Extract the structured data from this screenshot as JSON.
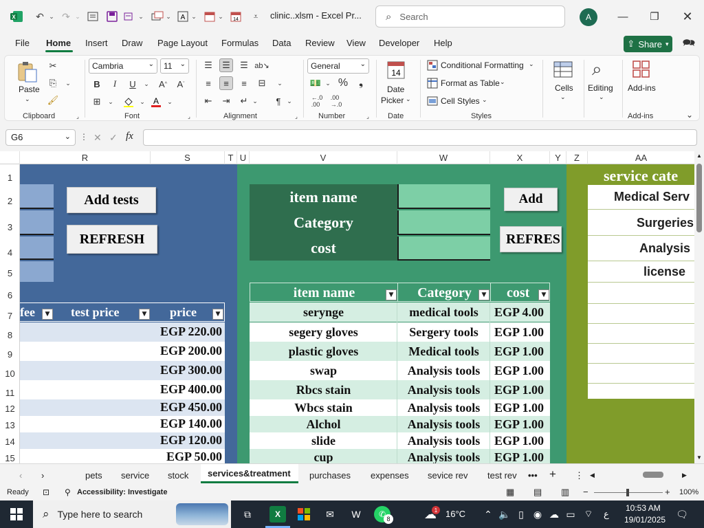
{
  "title_bar": {
    "doc_title": "clinic..xlsm - Excel Pr...",
    "search_placeholder": "Search",
    "avatar_initial": "A"
  },
  "menu": {
    "tabs": [
      "File",
      "Home",
      "Insert",
      "Draw",
      "Page Layout",
      "Formulas",
      "Data",
      "Review",
      "View",
      "Developer",
      "Help"
    ],
    "share_label": "Share"
  },
  "ribbon": {
    "clipboard": {
      "paste": "Paste",
      "label": "Clipboard"
    },
    "font": {
      "name": "Cambria",
      "size": "11",
      "label": "Font"
    },
    "alignment": {
      "label": "Alignment"
    },
    "number": {
      "format": "General",
      "label": "Number"
    },
    "date": {
      "line1": "Date",
      "line2": "Picker",
      "label": "Date",
      "icon_num": "14"
    },
    "styles": {
      "conditional": "Conditional Formatting",
      "format_table": "Format as Table",
      "cell_styles": "Cell Styles",
      "label": "Styles"
    },
    "cells": {
      "label": "Cells"
    },
    "editing": {
      "label": "Editing"
    },
    "addins": {
      "button": "Add-ins",
      "label": "Add-ins"
    }
  },
  "formula_bar": {
    "name_box": "G6",
    "fx": "fx",
    "value": ""
  },
  "columns": [
    "R",
    "S",
    "T",
    "U",
    "V",
    "W",
    "X",
    "Y",
    "Z",
    "AA"
  ],
  "rows": [
    "1",
    "2",
    "3",
    "4",
    "5",
    "6",
    "7",
    "8",
    "9",
    "10",
    "11",
    "12",
    "13",
    "14",
    "15"
  ],
  "tests_section": {
    "add_button": "Add tests",
    "refresh_button": "REFRESH",
    "headers": [
      "fee",
      "test price",
      "price"
    ],
    "prices": [
      "EGP 220.00",
      "EGP 200.00",
      "EGP 300.00",
      "EGP 400.00",
      "EGP 450.00",
      "EGP 140.00",
      "EGP 120.00",
      "EGP 50.00"
    ]
  },
  "item_section": {
    "form_labels": [
      "item name",
      "Category",
      "cost"
    ],
    "add_button": "Add",
    "refresh_button": "REFRES",
    "headers": [
      "item name",
      "Category",
      "cost"
    ],
    "rows": [
      {
        "name": "serynge",
        "category": "medical tools",
        "cost": "EGP 4.00"
      },
      {
        "name": "segery gloves",
        "category": "Sergery tools",
        "cost": "EGP 1.00"
      },
      {
        "name": "plastic gloves",
        "category": "Medical tools",
        "cost": "EGP 1.00"
      },
      {
        "name": "swap",
        "category": "Analysis tools",
        "cost": "EGP 1.00"
      },
      {
        "name": "Rbcs stain",
        "category": "Analysis tools",
        "cost": "EGP 1.00"
      },
      {
        "name": "Wbcs stain",
        "category": "Analysis tools",
        "cost": "EGP 1.00"
      },
      {
        "name": "Alchol",
        "category": "Analysis tools",
        "cost": "EGP 1.00"
      },
      {
        "name": "slide",
        "category": "Analysis tools",
        "cost": "EGP 1.00"
      },
      {
        "name": "cup",
        "category": "Analysis tools",
        "cost": "EGP 1.00"
      }
    ]
  },
  "service_section": {
    "title": "service cate",
    "items": [
      "Medical Serv",
      "Surgeries",
      "Analysis",
      "license"
    ]
  },
  "sheet_tabs": [
    "pets",
    "service",
    "stock",
    "services&treatment",
    "purchases",
    "expenses",
    "sevice rev",
    "test rev"
  ],
  "active_sheet": "services&treatment",
  "status": {
    "ready": "Ready",
    "accessibility": "Accessibility: Investigate",
    "zoom": "100%"
  },
  "taskbar": {
    "search_placeholder": "Type here to search",
    "weather": "16°C",
    "time": "10:53 AM",
    "date": "19/01/2025",
    "lang": "ع",
    "whatsapp_badge": "8",
    "weather_badge": "1"
  },
  "colors": {
    "blue_band": "#43689a",
    "green_band": "#3d9970",
    "olive_band": "#809c2a",
    "form_dark": "#2f6e4e",
    "form_input": "#7dcfa6",
    "row_blue": "#dce5f1",
    "row_green": "#d5eee2",
    "excel_green": "#107c41"
  }
}
